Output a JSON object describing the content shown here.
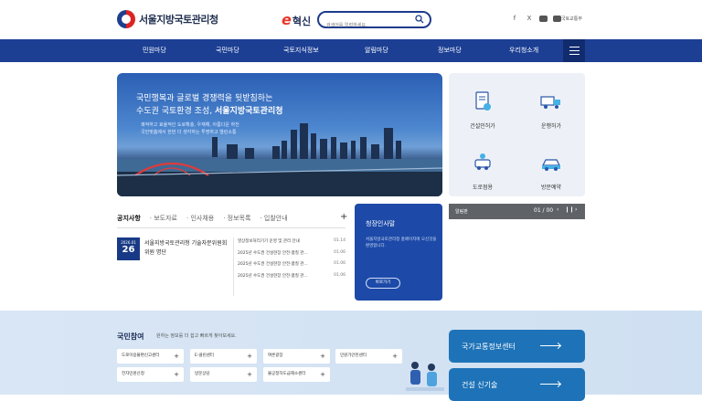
{
  "header": {
    "logo_text": "서울지방국토관리청",
    "innovation_e": "e",
    "innovation_text": "혁신",
    "search_placeholder": "검색어를 입력하세요.",
    "ministry_link": "국토교통부",
    "social": [
      "f",
      "X",
      "blog",
      "youtube"
    ]
  },
  "nav": {
    "items": [
      "민원마당",
      "국민마당",
      "국토지식정보",
      "알림마당",
      "정보마당",
      "우리청소개"
    ]
  },
  "hero": {
    "line1": "국민행복과 글로벌 경쟁력을 뒷받침하는",
    "line2a": "수도권 국토환경 조성,",
    "line2b": "서울지방국토관리청",
    "line3": "쾌적하고 효율적인 도로확충, 우재해, 아름다운 하천",
    "line4": "국민맞춤에서 한번 더 생각하는 투명하고 열린소통"
  },
  "quick": {
    "items": [
      {
        "label": "건설인허가",
        "icon": "document-approval-icon"
      },
      {
        "label": "운행허가",
        "icon": "truck-icon"
      },
      {
        "label": "도로점용",
        "icon": "road-occupancy-icon"
      },
      {
        "label": "방문예약",
        "icon": "visit-car-icon"
      }
    ]
  },
  "news": {
    "tabs": [
      "공지사항",
      "보도자료",
      "인사채용",
      "정보목록",
      "입찰안내"
    ],
    "more": "+",
    "featured": {
      "ym": "2026.01",
      "day": "26",
      "title": "서울지방국토관리청 기술자문위원회 위원 명단"
    },
    "rows": [
      {
        "title": "영상정보처리기기 운영 및 관리 안내",
        "date": "01.14"
      },
      {
        "title": "2025년 수도권 건설현장 안전·품질 관...",
        "date": "01.06"
      },
      {
        "title": "2025년 수도권 건설현장 안전·품질 관...",
        "date": "01.06"
      },
      {
        "title": "2025년 수도권 건설현장 안전·품질 관...",
        "date": "01.06"
      }
    ]
  },
  "greeting": {
    "title": "청장인사말",
    "desc": "서울지방국토관리청 홈페이지에 오신것을 환영합니다.",
    "button": "바로가기"
  },
  "notice": {
    "label": "알림판",
    "count": "01 / 00",
    "prev": "‹",
    "pause": "❙❙",
    "next": "›"
  },
  "participation": {
    "title": "국민참여",
    "desc": "원하는 정보를 더 쉽고 빠르게 찾아보세요.",
    "buttons": [
      "도로이용불편신고센터",
      "E-클린센터",
      "여론광장",
      "민원가안된센터",
      "전자민원신청",
      "방문상담",
      "불공정하도급해소센터"
    ]
  },
  "side_cards": [
    "국가교통정보센터",
    "건설 신기술"
  ],
  "colors": {
    "primary": "#1c3f94",
    "accent": "#1e73b8",
    "logo_red": "#e8382a"
  }
}
